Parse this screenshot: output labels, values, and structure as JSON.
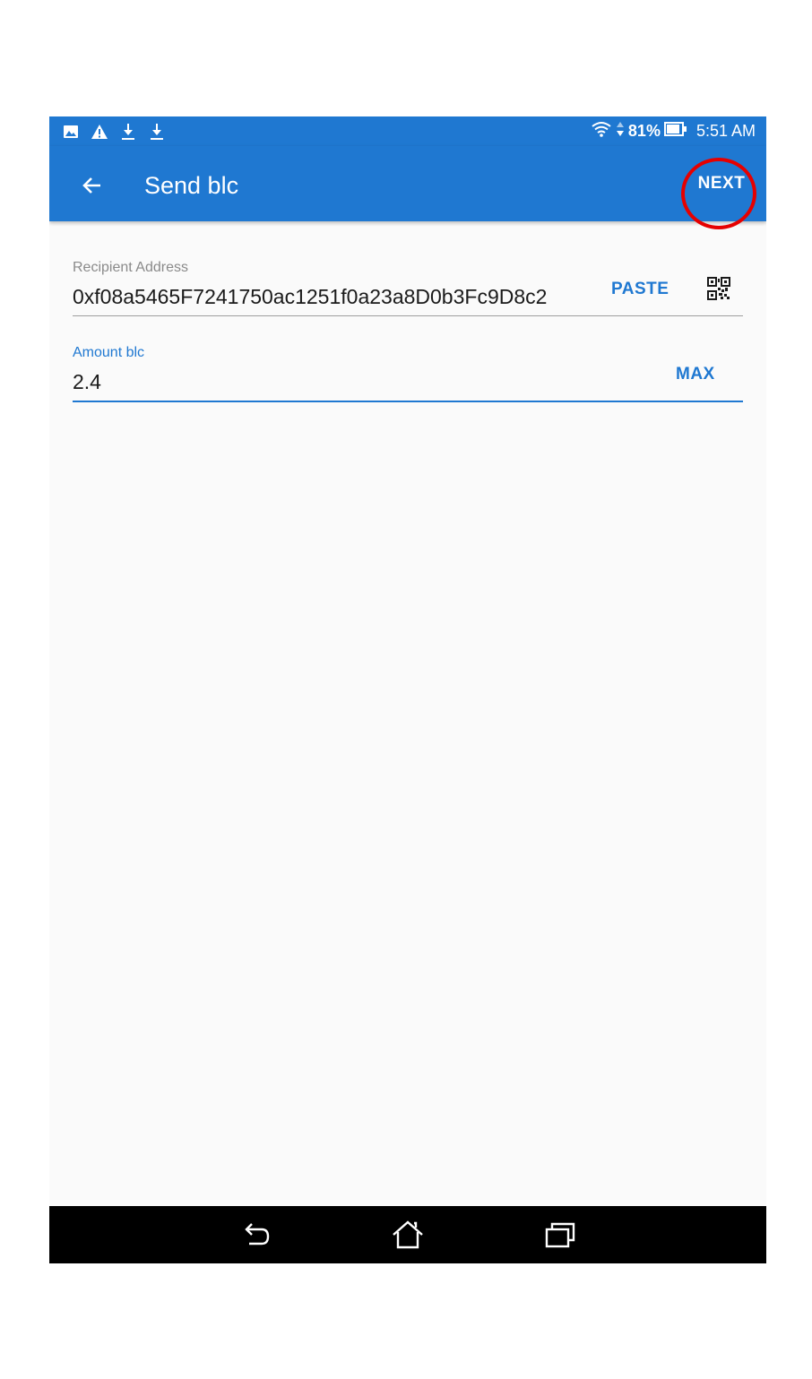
{
  "status_bar": {
    "icons_left": [
      "image-icon",
      "warning-icon",
      "download-icon",
      "download-icon"
    ],
    "battery": "81%",
    "time": "5:51 AM"
  },
  "app_bar": {
    "title": "Send blc",
    "next_label": "NEXT"
  },
  "recipient": {
    "label": "Recipient Address",
    "value": "0xf08a5465F7241750ac1251f0a23a8D0b3Fc9D8c2",
    "paste_label": "PASTE"
  },
  "amount": {
    "label": "Amount blc",
    "value": "2.4",
    "max_label": "MAX"
  },
  "colors": {
    "primary": "#1f78d1",
    "highlight": "#e60000",
    "background": "#fafafa"
  }
}
